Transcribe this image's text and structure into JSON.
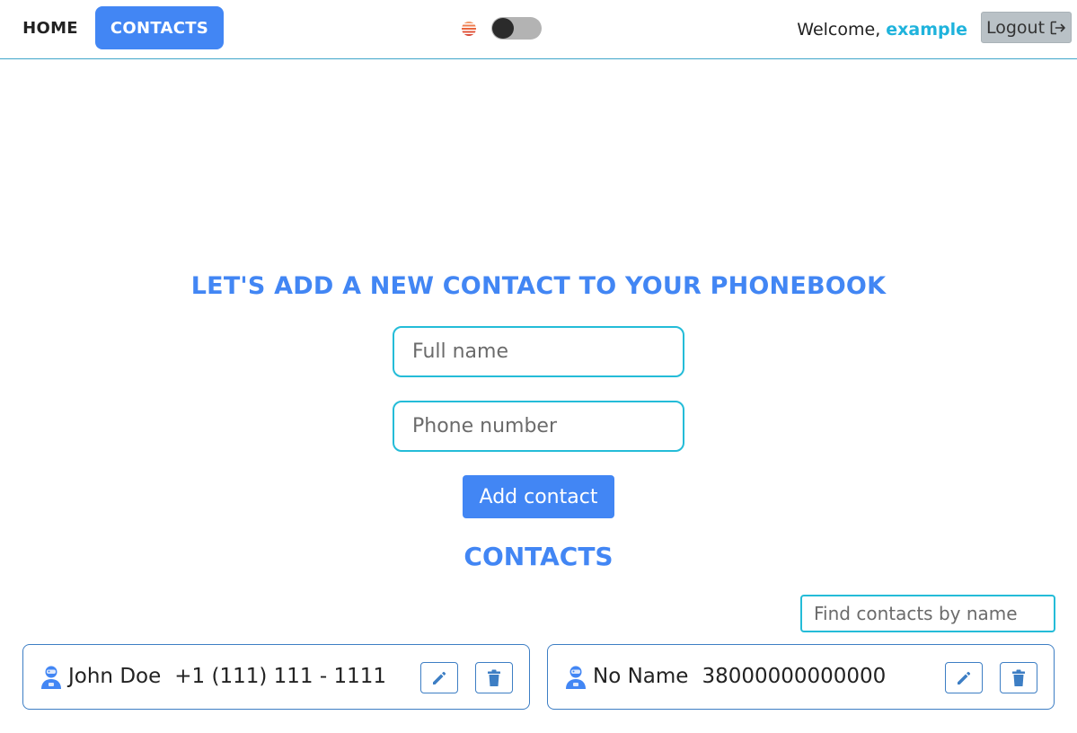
{
  "nav": {
    "home_label": "HOME",
    "contacts_label": "CONTACTS"
  },
  "theme_toggle": {
    "icon": "sun-icon",
    "state": "off"
  },
  "user": {
    "welcome_text": "Welcome,",
    "username": "example",
    "logout_label": "Logout",
    "logout_icon": "logout-icon"
  },
  "form": {
    "title": "LET'S ADD A NEW CONTACT TO YOUR PHONEBOOK",
    "name_placeholder": "Full name",
    "name_value": "",
    "phone_placeholder": "Phone number",
    "phone_value": "",
    "submit_label": "Add contact"
  },
  "contacts_section": {
    "title": "CONTACTS",
    "search_placeholder": "Find contacts by name",
    "search_value": ""
  },
  "contacts": [
    {
      "name": "John Doe",
      "number": "+1 (111) 111 - 1111",
      "icon": "user-icon"
    },
    {
      "name": "No Name",
      "number": "38000000000000",
      "icon": "user-icon"
    }
  ],
  "colors": {
    "accent": "#4286f4",
    "input_border": "#24bcd8",
    "username": "#1fb3dc",
    "card_border": "#3d7ec4",
    "logout_bg": "#b9c1c6"
  }
}
